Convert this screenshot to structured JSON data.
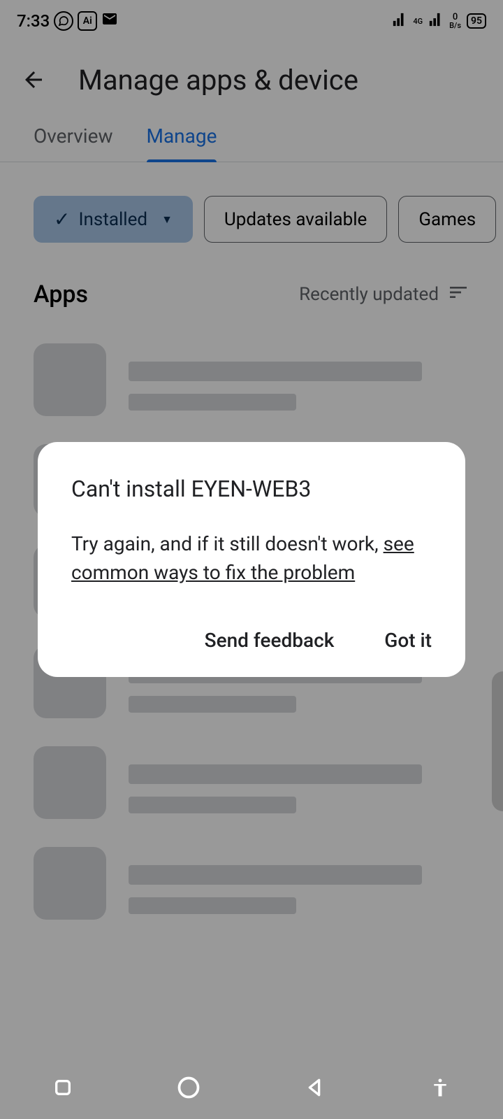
{
  "statusBar": {
    "time": "7:33",
    "aiLabel": "Ai",
    "networkLabel": "4G",
    "dataRate": "0",
    "dataUnit": "B/s",
    "battery": "95"
  },
  "header": {
    "title": "Manage apps & device"
  },
  "tabs": {
    "overview": "Overview",
    "manage": "Manage"
  },
  "filters": {
    "installed": "Installed",
    "updates": "Updates available",
    "games": "Games"
  },
  "section": {
    "title": "Apps",
    "sort": "Recently updated"
  },
  "dialog": {
    "title": "Can't install EYEN-WEB3",
    "bodyPrefix": "Try again, and if it still doesn't work, ",
    "bodyLink": "see common ways to fix the problem",
    "sendFeedback": "Send feedback",
    "gotIt": "Got it"
  }
}
